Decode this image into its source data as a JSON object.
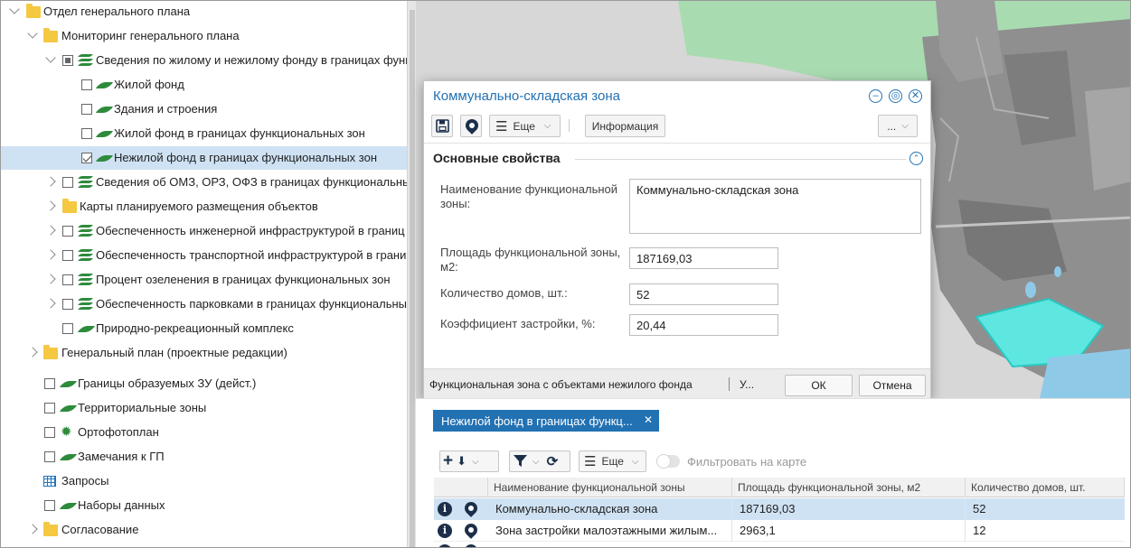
{
  "tree": [
    {
      "label": "Отдел генерального плана"
    },
    {
      "label": "Мониторинг генерального плана"
    },
    {
      "label": "Сведения по жилому и нежилому фонду в границах функ"
    },
    {
      "label": "Жилой фонд"
    },
    {
      "label": "Здания и строения"
    },
    {
      "label": "Жилой фонд в границах функциональных зон"
    },
    {
      "label": "Нежилой фонд в границах функциональных зон"
    },
    {
      "label": "Сведения об ОМЗ, ОРЗ, ОФЗ в границах функциональны"
    },
    {
      "label": "Карты планируемого размещения объектов"
    },
    {
      "label": "Обеспеченность инженерной инфраструктурой в границ"
    },
    {
      "label": "Обеспеченность транспортной инфраструктурой в грани"
    },
    {
      "label": "Процент озеленения в границах функциональных зон"
    },
    {
      "label": "Обеспеченность парковками в границах функциональны"
    },
    {
      "label": "Природно-рекреационный комплекс"
    },
    {
      "label": "Генеральный план (проектные редакции)"
    },
    {
      "label": "Границы образуемых ЗУ (дейст.)"
    },
    {
      "label": "Территориальные зоны"
    },
    {
      "label": "Ортофотоплан"
    },
    {
      "label": "Замечания к ГП"
    },
    {
      "label": "Запросы"
    },
    {
      "label": "Наборы данных"
    },
    {
      "label": "Согласование"
    }
  ],
  "dialog": {
    "title": "Коммунально-складская зона",
    "more_label": "Еще",
    "info_label": "Информация",
    "ellipsis_label": "...",
    "section_title": "Основные свойства",
    "fields": [
      {
        "label": "Наименование функциональной зоны:",
        "value": "Коммунально-складская зона"
      },
      {
        "label": "Площадь функциональной зоны, м2:",
        "value": "187169,03"
      },
      {
        "label": "Количество домов, шт.:",
        "value": "52"
      },
      {
        "label": "Коэффициент застройки, %:",
        "value": "20,44"
      }
    ],
    "footer_text": "Функциональная зона с объектами нежилого фонда",
    "footer_more": "У...",
    "ok_label": "ОК",
    "cancel_label": "Отмена"
  },
  "bottom": {
    "tab_label": "Нежилой фонд в границах функц...",
    "more_label": "Еще",
    "filter_on_map_label": "Фильтровать на карте",
    "columns": [
      "Наименование функциональной зоны",
      "Площадь функциональной зоны, м2",
      "Количество домов, шт."
    ],
    "rows": [
      [
        "Коммунально-складская зона",
        "187169,03",
        "52"
      ],
      [
        "Зона застройки малоэтажными жилым...",
        "2963,1",
        "12"
      ]
    ]
  },
  "colors": {
    "accent": "#2271b3",
    "selection": "#cfe2f3",
    "layer_green": "#2e8b3c",
    "folder": "#f5c842"
  }
}
